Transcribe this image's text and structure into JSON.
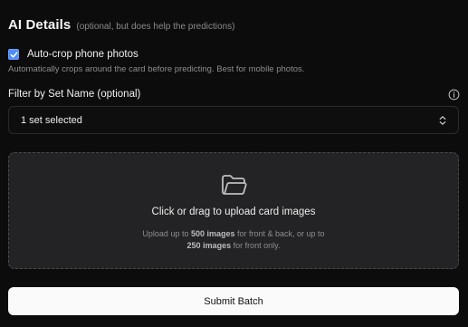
{
  "header": {
    "title": "AI Details",
    "note": "(optional, but does help the predictions)"
  },
  "autocrop": {
    "checked": true,
    "label": "Auto-crop phone photos",
    "help": "Automatically crops around the card before predicting. Best for mobile photos."
  },
  "filter": {
    "label": "Filter by Set Name (optional)",
    "selected": "1 set selected",
    "icons": {
      "info": "info-icon",
      "chevrons": "chevron-up-down-icon"
    }
  },
  "upload": {
    "icon": "folder-open-icon",
    "main_text": "Click or drag to upload card images",
    "sub_prefix": "Upload up to ",
    "sub_limit_1": "500 images",
    "sub_middle": " for front & back, or up to",
    "sub_limit_2": "250 images",
    "sub_suffix": " for front only."
  },
  "submit": {
    "label": "Submit Batch"
  },
  "colors": {
    "background": "#0c0c0c",
    "checkbox_accent": "#4f8ef7",
    "dropzone_bg": "#232325",
    "button_bg": "#fafafa"
  }
}
